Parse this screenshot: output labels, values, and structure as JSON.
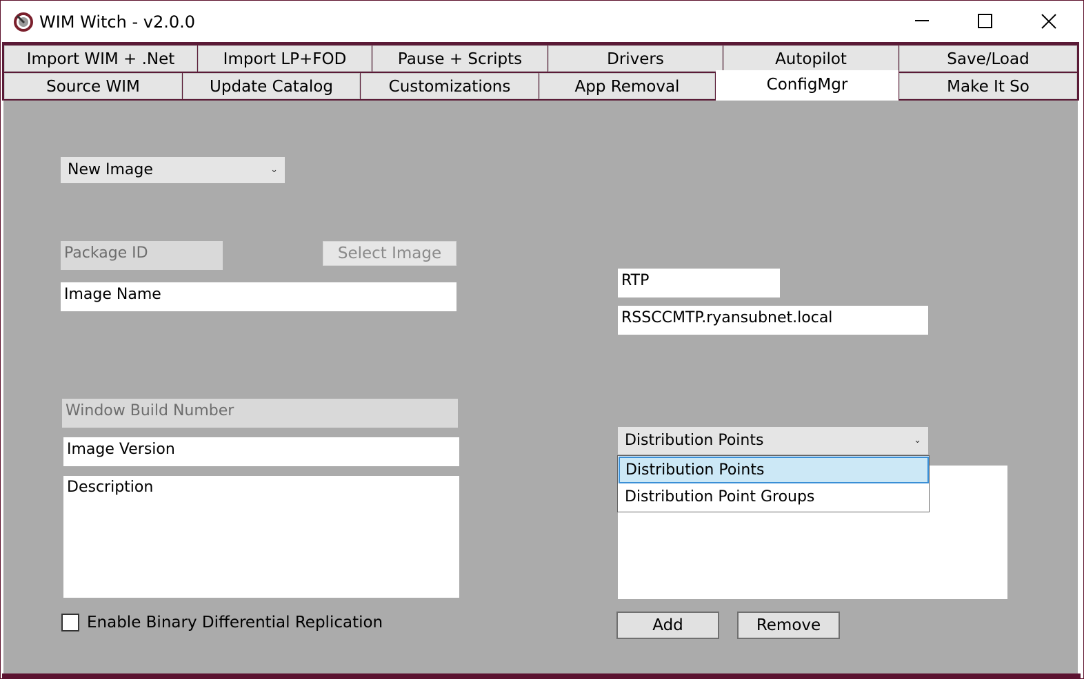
{
  "window": {
    "title": "WIM Witch - v2.0.0",
    "controls": {
      "minimize": "minimize",
      "maximize": "maximize",
      "close": "close"
    }
  },
  "tabs_row1": [
    {
      "label": "Import WIM + .Net"
    },
    {
      "label": "Import LP+FOD"
    },
    {
      "label": "Pause + Scripts"
    },
    {
      "label": "Drivers"
    },
    {
      "label": "Autopilot"
    },
    {
      "label": "Save/Load"
    }
  ],
  "tabs_row2": [
    {
      "label": "Source WIM"
    },
    {
      "label": "Update Catalog"
    },
    {
      "label": "Customizations"
    },
    {
      "label": "App Removal"
    },
    {
      "label": "ConfigMgr",
      "selected": true
    },
    {
      "label": "Make It So"
    }
  ],
  "configmgr": {
    "image_type_combo": "New Image",
    "package_id": "Package ID",
    "select_image_button": "Select Image",
    "image_name": "Image Name",
    "build_number": "Window Build Number",
    "image_version": "Image Version",
    "description": "Description",
    "binary_diff_label": "Enable Binary Differential Replication",
    "binary_diff_checked": false,
    "site_code": "RTP",
    "site_server": "RSSCCMTP.ryansubnet.local",
    "dp_combo": "Distribution Points",
    "dp_options": [
      "Distribution Points",
      "Distribution Point Groups"
    ],
    "add_button": "Add",
    "remove_button": "Remove"
  },
  "colors": {
    "frame": "#5b0f2a",
    "content_bg": "#ababab",
    "dropdown_highlight": "#cce8f6",
    "dropdown_highlight_border": "#3a8fd6"
  }
}
